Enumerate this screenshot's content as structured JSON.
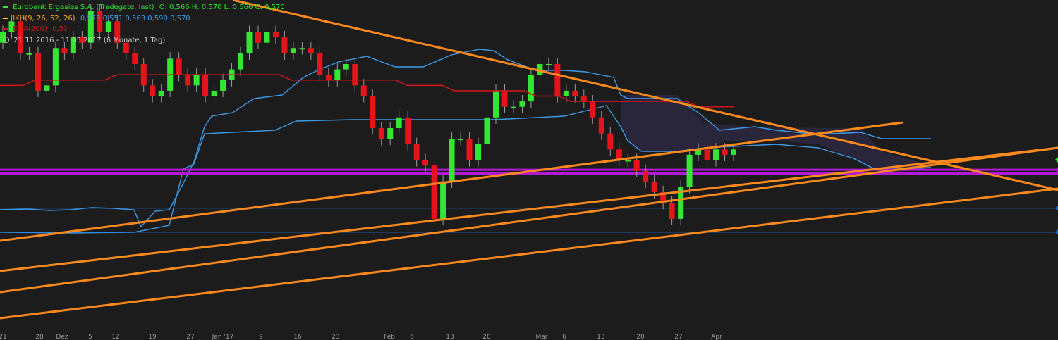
{
  "legend": {
    "instrument": "Eurobank Ergasias S.A. (Tradegate, last)",
    "ohlc": "O: 0,566  H: 0,570  L: 0,566  C: 0,570",
    "ikh_label": "IKH(9, 26, 52, 26)",
    "ikh_values": "0,575  0,551  0,563  0,590  0,570",
    "ema_label": "EMA(200)",
    "ema_value": "0,5?",
    "range": "21.11.2016 - 11.05.2017  (6 Monate, 1 Tag)"
  },
  "colors": {
    "background": "#1c1c1c",
    "up": "#33e633",
    "down": "#e6131a",
    "ema": "#c8161b",
    "ichimoku": "#3d9ae6",
    "cloud": "#2b2840",
    "trendline": "#ff8a1c",
    "support": "#b31ad6",
    "level": "#1f6fd4"
  },
  "chart_data": {
    "type": "candlestick",
    "x_tick_labels": [
      "21",
      "28",
      "Dez",
      "5",
      "12",
      "19",
      "27",
      "Jan '17",
      "9",
      "16",
      "23",
      "Feb",
      "6",
      "13",
      "20",
      "Mär",
      "6",
      "13",
      "20",
      "27",
      "Apr"
    ],
    "ylim": [
      0.2,
      0.8
    ],
    "series": [
      {
        "name": "price",
        "values": [
          0.74,
          0.76,
          0.7,
          0.7,
          0.63,
          0.64,
          0.71,
          0.7,
          0.73,
          0.72,
          0.78,
          0.74,
          0.76,
          0.72,
          0.7,
          0.68,
          0.64,
          0.62,
          0.63,
          0.69,
          0.66,
          0.64,
          0.66,
          0.62,
          0.63,
          0.65,
          0.67,
          0.7,
          0.74,
          0.72,
          0.74,
          0.73,
          0.7,
          0.71,
          0.71,
          0.7,
          0.66,
          0.65,
          0.67,
          0.68,
          0.64,
          0.62,
          0.56,
          0.54,
          0.56,
          0.58,
          0.53,
          0.5,
          0.49,
          0.39,
          0.46,
          0.54,
          0.54,
          0.5,
          0.53,
          0.58,
          0.63,
          0.6,
          0.6,
          0.61,
          0.66,
          0.68,
          0.68,
          0.62,
          0.63,
          0.62,
          0.61,
          0.58,
          0.55,
          0.52,
          0.5,
          0.5,
          0.48,
          0.46,
          0.44,
          0.42,
          0.39,
          0.45,
          0.51,
          0.52,
          0.5,
          0.52,
          0.51,
          0.52
        ]
      },
      {
        "name": "EMA(200)",
        "values": [
          0.64,
          0.64,
          0.64,
          0.65,
          0.65,
          0.65,
          0.65,
          0.65,
          0.65,
          0.65,
          0.66,
          0.66,
          0.66,
          0.66,
          0.66,
          0.66,
          0.66,
          0.66,
          0.66,
          0.66,
          0.66,
          0.66,
          0.66,
          0.66,
          0.66,
          0.65,
          0.65,
          0.65,
          0.65,
          0.65,
          0.65,
          0.65,
          0.65,
          0.65,
          0.65,
          0.64,
          0.64,
          0.64,
          0.64,
          0.63,
          0.63,
          0.63,
          0.63,
          0.63,
          0.63,
          0.63,
          0.62,
          0.62,
          0.62,
          0.61,
          0.61,
          0.61,
          0.61,
          0.61,
          0.61,
          0.61,
          0.61,
          0.61,
          0.61,
          0.61,
          0.6,
          0.6,
          0.6,
          0.6
        ]
      }
    ],
    "horizontal_levels": [
      0.482,
      0.475,
      0.41,
      0.365
    ],
    "grid": false,
    "legend_position": "top-left"
  }
}
